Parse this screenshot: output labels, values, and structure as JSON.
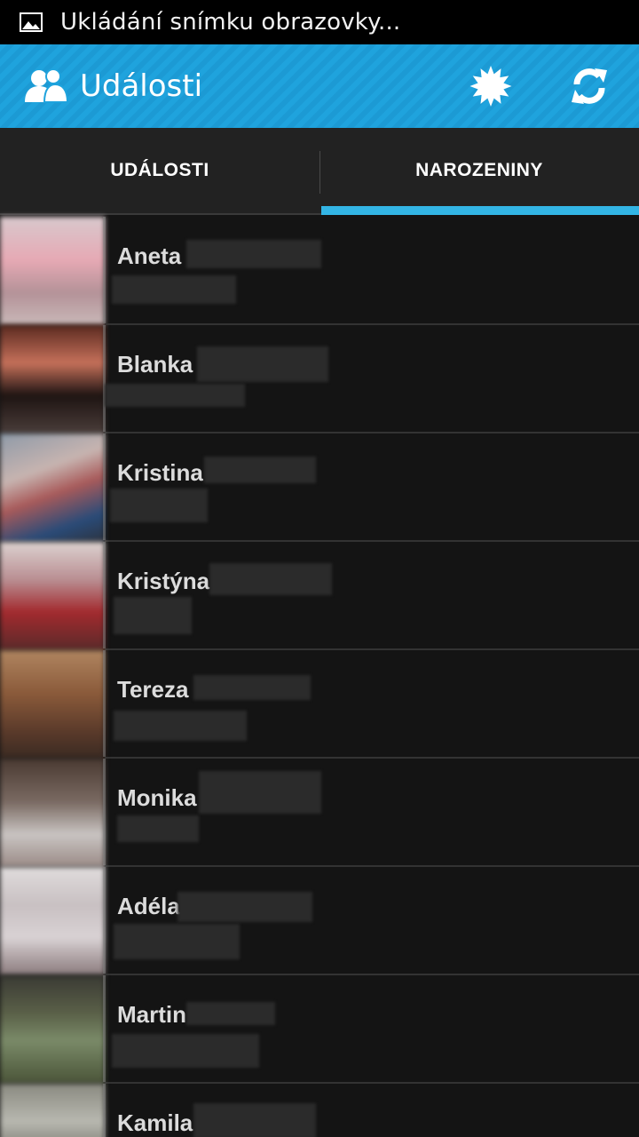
{
  "status_bar": {
    "icon": "image-icon",
    "text": "Ukládání snímku obrazovky..."
  },
  "action_bar": {
    "icon": "people-icon",
    "title": "Události",
    "actions": [
      {
        "icon": "sun-icon"
      },
      {
        "icon": "refresh-icon"
      }
    ],
    "accent_color": "#1fa3dd"
  },
  "tabs": [
    {
      "label": "UDÁLOSTI",
      "active": false
    },
    {
      "label": "NAROZENINY",
      "active": true
    }
  ],
  "tab_indicator_color": "#33b5e5",
  "contacts": [
    {
      "name": "Aneta"
    },
    {
      "name": "Blanka"
    },
    {
      "name": "Kristina"
    },
    {
      "name": "Kristýna"
    },
    {
      "name": "Tereza"
    },
    {
      "name": "Monika"
    },
    {
      "name": "Adéla"
    },
    {
      "name": "Martin"
    },
    {
      "name": "Kamila"
    }
  ]
}
